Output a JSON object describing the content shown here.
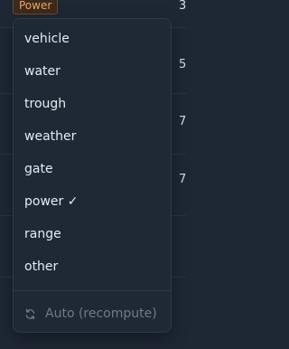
{
  "chip": {
    "label": "Power"
  },
  "background_values": [
    "3",
    "5",
    "7",
    "7"
  ],
  "menu": {
    "items": [
      {
        "label": "vehicle"
      },
      {
        "label": "water"
      },
      {
        "label": "trough"
      },
      {
        "label": "weather"
      },
      {
        "label": "gate"
      },
      {
        "label": "power ✓"
      },
      {
        "label": "range"
      },
      {
        "label": "other"
      }
    ],
    "auto_label": "Auto (recompute)",
    "auto_icon": "refresh-icon"
  },
  "colors": {
    "background": "#1e2734",
    "menu_background": "#1f2835",
    "chip_text": "#f0a35a",
    "item_text": "#e6ebf2",
    "disabled_text": "#6f7a89"
  }
}
